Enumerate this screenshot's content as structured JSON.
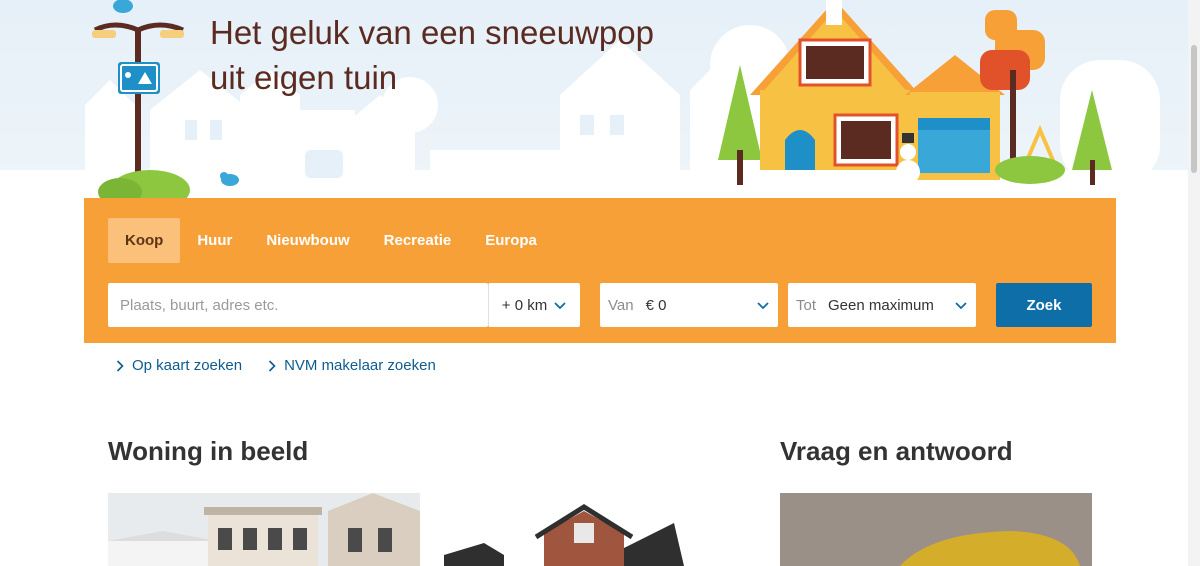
{
  "hero": {
    "tagline_line1": "Het geluk van een sneeuwpop",
    "tagline_line2": "uit eigen tuin"
  },
  "search": {
    "tabs": [
      {
        "label": "Koop",
        "active": true
      },
      {
        "label": "Huur",
        "active": false
      },
      {
        "label": "Nieuwbouw",
        "active": false
      },
      {
        "label": "Recreatie",
        "active": false
      },
      {
        "label": "Europa",
        "active": false
      }
    ],
    "location_placeholder": "Plaats, buurt, adres etc.",
    "location_value": "",
    "radius_value": "+ 0 km",
    "price_from_label": "Van",
    "price_from_value": "€ 0",
    "price_to_label": "Tot",
    "price_to_value": "Geen maximum",
    "submit_label": "Zoek"
  },
  "quick_links": [
    {
      "label": "Op kaart zoeken"
    },
    {
      "label": "NVM makelaar zoeken"
    }
  ],
  "sections": {
    "woning_title": "Woning in beeld",
    "vraag_title": "Vraag en antwoord"
  },
  "colors": {
    "panel": "#f7a037",
    "active_tab": "#fbc17a",
    "search_button": "#0e6ea8",
    "link": "#0e5c8f",
    "tagline": "#5b2a20"
  },
  "icons": [
    "chevron-down-icon",
    "chevron-right-icon",
    "house-illustration",
    "streetlamp-illustration",
    "bird-icon"
  ]
}
